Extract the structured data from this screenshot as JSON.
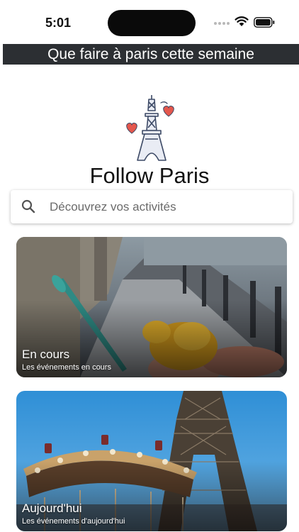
{
  "status_bar": {
    "time": "5:01"
  },
  "banner": {
    "text": "Que faire à paris cette semaine"
  },
  "app": {
    "title": "Follow Paris",
    "logo_icon": "eiffel-tower-hearts-icon"
  },
  "search": {
    "placeholder": "Découvrez vos activités",
    "value": "",
    "icon": "search-icon"
  },
  "cards": [
    {
      "title": "En cours",
      "subtitle": "Les événements en cours",
      "image": "ice-cream-street-photo"
    },
    {
      "title": "Aujourd'hui",
      "subtitle": "Les événements d'aujourd'hui",
      "image": "carousel-eiffel-tower-photo"
    }
  ],
  "colors": {
    "banner_bg": "#2c2f33",
    "heart": "#e4574d",
    "tower": "#3d4a66"
  }
}
